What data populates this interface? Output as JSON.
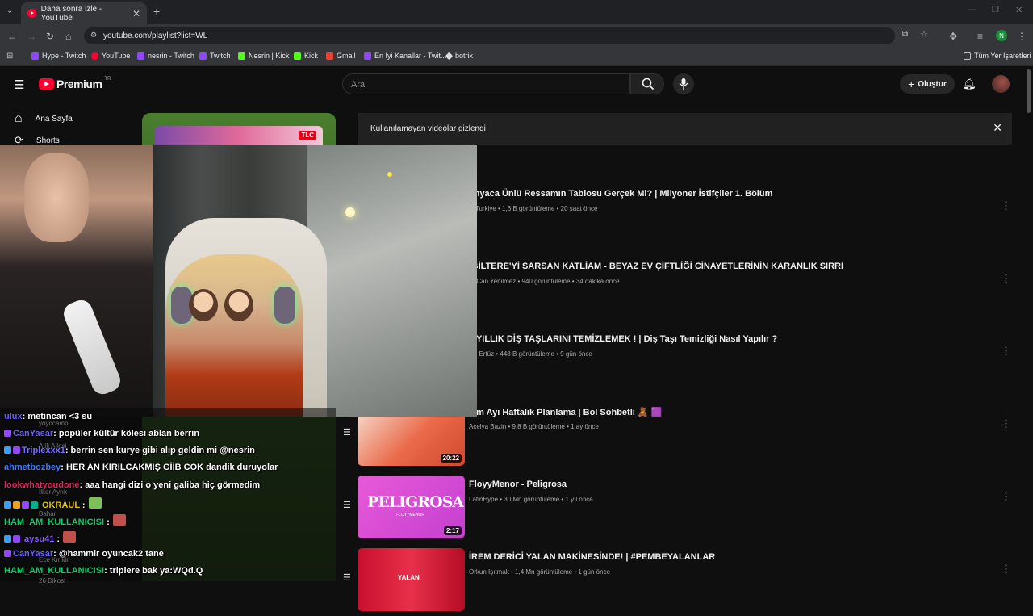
{
  "browser": {
    "tab_title": "Daha sonra izle - YouTube",
    "url": "youtube.com/playlist?list=WL",
    "profile_initial": "N",
    "bookmarks": [
      "Hype - Twitch",
      "YouTube",
      "nesrin - Twitch",
      "Twitch",
      "Nesrin | Kick",
      "Kick",
      "Gmail",
      "En İyi Kanallar - Twit...",
      "botrix"
    ],
    "all_bookmarks": "Tüm Yer İşaretleri"
  },
  "youtube": {
    "logo_text": "Premium",
    "logo_country": "TR",
    "search_placeholder": "Ara",
    "create_label": "Oluştur",
    "sidebar": [
      "Ana Sayfa",
      "Shorts"
    ],
    "banner_text": "Kullanılamayan videolar gizlendi",
    "videos": [
      {
        "title": "ünyaca Ünlü Ressamın Tablosu Gerçek Mi? | Milyoner İstifçiler 1. Bölüm",
        "meta": "C Turkiye • 1,6 B görüntüleme • 20 saat önce",
        "duration": ""
      },
      {
        "title": "IGİLTERE'Yİ SARSAN KATLİAM - BEYAZ EV ÇİFTLİĞİ CİNAYETLERİNİN KARANLIK SIRRI",
        "meta": "ur Can Yenilmez • 940 görüntüleme • 34 dakika önce",
        "duration": ""
      },
      {
        "title": "2 YILLIK DİŞ TAŞLARINI TEMİZLEMEK ! | Diş Taşı Temizliği Nasıl Yapılır ?",
        "meta": "niz Ertüz • 448 B görüntüleme • 9 gün önce",
        "duration": ""
      },
      {
        "title": "kim Ayı Haftalık Planlama | Bol Sohbetli 🧸 🟪",
        "meta": "Açelya Bazin • 9,8 B görüntüleme • 1 ay önce",
        "duration": "20:22"
      },
      {
        "title": "FloyyMenor - Peligrosa",
        "meta": "LatinHype • 30 Mn görüntüleme • 1 yıl önce",
        "duration": "2:17"
      },
      {
        "title": "İREM DERİCİ YALAN MAKİNESİNDE! | #PEMBEYALANLAR",
        "meta": "Orkun Işıtmak • 1,4 Mn görüntüleme • 1 gün önce",
        "duration": ""
      }
    ],
    "thumb_texts": {
      "peligrosa": "PELIGROSA",
      "floyymenor": "FLOYYMENOR",
      "yalan": "YALAN",
      "tlc": "TLC"
    }
  },
  "chat": [
    {
      "user": "CanYasar",
      "text": ": popüler kültür kölesi ablan berrin",
      "color": "#6a5cff"
    },
    {
      "user": "Triplexxx1",
      "text": ": berrin sen kurye gibi alıp geldin mi @nesrin",
      "color": "#7b6cff"
    },
    {
      "user": "ahmetbozbey",
      "text": ": HER AN KIRILCAKMIŞ GİİB COK dandik duruyolar",
      "color": "#3a7bff"
    },
    {
      "user": "lookwhatyoudone",
      "text": ": aaa hangi dizi o yeni galiba hiç görmedim",
      "color": "#e0245e"
    },
    {
      "user": "OKRAUL",
      "text": " :",
      "color": "#e6c200"
    },
    {
      "user": "HAM_AM_KULLANICISI",
      "text": " :",
      "color": "#00d26a"
    },
    {
      "user": "aysu41",
      "text": " :",
      "color": "#8a5cff"
    },
    {
      "user": "CanYasar",
      "text": ": @hammir oyuncak2 tane",
      "color": "#6a5cff"
    },
    {
      "user": "HAM_AM_KULLANICISI",
      "text": ": triplere bak ya:WQd.Q",
      "color": "#00d26a"
    }
  ],
  "chat_top_partial": {
    "user": "ulux",
    "text": ": metincan <3 su"
  },
  "chat_ghost": [
    "yoyocamp",
    "Atik Ailesi",
    "İlker Ayrık",
    "Bahar",
    "Ece Kırıldı",
    "26 Dikost"
  ],
  "colors": {
    "youtube_red": "#ff0033",
    "bg": "#0f0f0f",
    "playlist_green": "#4a7f2e"
  }
}
